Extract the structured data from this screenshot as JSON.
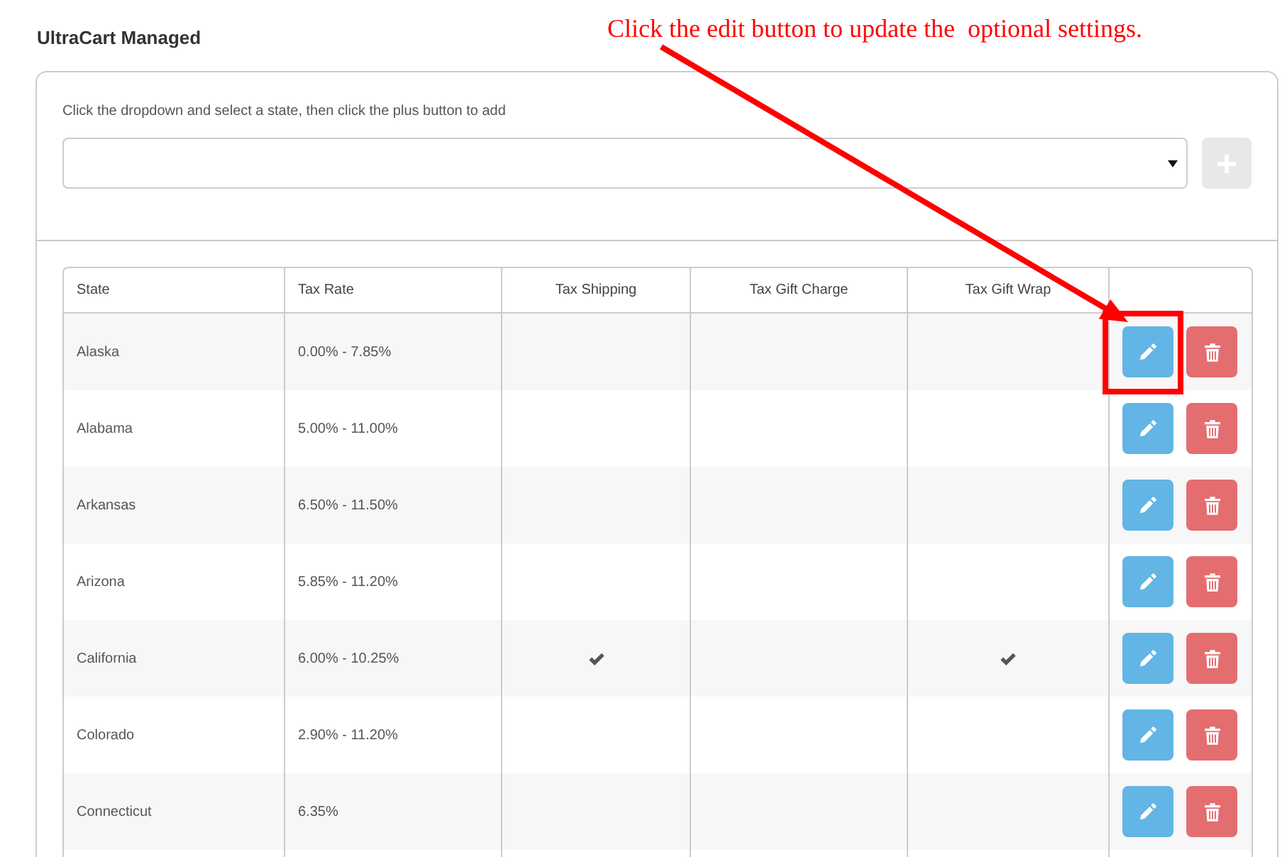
{
  "page_title": "UltraCart Managed",
  "annotation": {
    "text": "Click the edit button to update the  optional settings."
  },
  "instructions": "Click the dropdown and select a state, then click the plus button to add",
  "add_button": {
    "disabled": true
  },
  "table": {
    "columns": [
      {
        "label": "State",
        "kind": "text"
      },
      {
        "label": "Tax Rate",
        "kind": "text"
      },
      {
        "label": "Tax Shipping",
        "kind": "check"
      },
      {
        "label": "Tax Gift Charge",
        "kind": "check"
      },
      {
        "label": "Tax Gift Wrap",
        "kind": "check"
      }
    ],
    "rows": [
      {
        "state": "Alaska",
        "tax_rate": "0.00% - 7.85%",
        "tax_shipping": false,
        "tax_gift_charge": false,
        "tax_gift_wrap": false,
        "highlighted": true
      },
      {
        "state": "Alabama",
        "tax_rate": "5.00% - 11.00%",
        "tax_shipping": false,
        "tax_gift_charge": false,
        "tax_gift_wrap": false,
        "highlighted": false
      },
      {
        "state": "Arkansas",
        "tax_rate": "6.50% - 11.50%",
        "tax_shipping": false,
        "tax_gift_charge": false,
        "tax_gift_wrap": false,
        "highlighted": false
      },
      {
        "state": "Arizona",
        "tax_rate": "5.85% - 11.20%",
        "tax_shipping": false,
        "tax_gift_charge": false,
        "tax_gift_wrap": false,
        "highlighted": false
      },
      {
        "state": "California",
        "tax_rate": "6.00% - 10.25%",
        "tax_shipping": true,
        "tax_gift_charge": false,
        "tax_gift_wrap": true,
        "highlighted": false
      },
      {
        "state": "Colorado",
        "tax_rate": "2.90% - 11.20%",
        "tax_shipping": false,
        "tax_gift_charge": false,
        "tax_gift_wrap": false,
        "highlighted": false
      },
      {
        "state": "Connecticut",
        "tax_rate": "6.35%",
        "tax_shipping": false,
        "tax_gift_charge": false,
        "tax_gift_wrap": false,
        "highlighted": false
      }
    ]
  }
}
